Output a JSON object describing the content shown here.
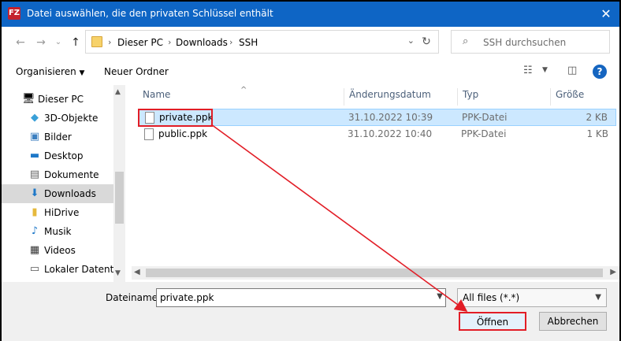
{
  "window": {
    "title": "Datei auswählen, die den privaten Schlüssel enthält",
    "app_icon_letters": "FZ"
  },
  "address": {
    "crumbs": [
      "Dieser PC",
      "Downloads",
      "SSH"
    ]
  },
  "search": {
    "placeholder": "SSH durchsuchen"
  },
  "toolbar": {
    "organize_label": "Organisieren",
    "new_folder_label": "Neuer Ordner"
  },
  "sidebar": {
    "items": [
      {
        "label": "Dieser PC",
        "icon": "computer-icon"
      },
      {
        "label": "3D-Objekte",
        "icon": "cube-icon"
      },
      {
        "label": "Bilder",
        "icon": "pictures-icon"
      },
      {
        "label": "Desktop",
        "icon": "desktop-icon"
      },
      {
        "label": "Dokumente",
        "icon": "documents-icon"
      },
      {
        "label": "Downloads",
        "icon": "downloads-icon"
      },
      {
        "label": "HiDrive",
        "icon": "folder-icon"
      },
      {
        "label": "Musik",
        "icon": "music-icon"
      },
      {
        "label": "Videos",
        "icon": "videos-icon"
      },
      {
        "label": "Lokaler Datenträger",
        "icon": "drive-icon"
      }
    ]
  },
  "columns": {
    "name": "Name",
    "date": "Änderungsdatum",
    "type": "Typ",
    "size": "Größe"
  },
  "files": [
    {
      "name": "private.ppk",
      "date": "31.10.2022 10:39",
      "type": "PPK-Datei",
      "size": "2 KB"
    },
    {
      "name": "public.ppk",
      "date": "31.10.2022 10:40",
      "type": "PPK-Datei",
      "size": "1 KB"
    }
  ],
  "footer": {
    "filename_label": "Dateiname:",
    "filename_value": "private.ppk",
    "filter_value": "All files (*.*)",
    "open_label": "Öffnen",
    "cancel_label": "Abbrechen"
  },
  "colors": {
    "titlebar": "#0e65c5",
    "selection": "#cce8ff",
    "annotation_red": "#e21d26"
  }
}
